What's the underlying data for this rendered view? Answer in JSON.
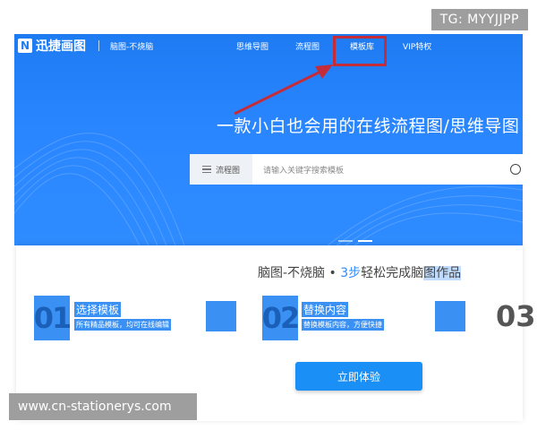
{
  "watermarks": {
    "top": "TG: MYYJJPP",
    "bottom": "www.cn-stationerys.com"
  },
  "header": {
    "logo_text": "迅捷画图",
    "slogan": "脑图-不烧脑",
    "nav": [
      "思维导图",
      "流程图",
      "模板库",
      "VIP特权"
    ]
  },
  "hero": {
    "headline": "一款小白也会用的在线流程图/思维导图",
    "search": {
      "type_label": "流程图",
      "placeholder": "请输入关键字搜索模板"
    }
  },
  "steps_section": {
    "subtitle_prefix": "脑图-不烧脑 • ",
    "subtitle_num": "3步",
    "subtitle_mid": "轻松完成脑",
    "subtitle_end": "图作品",
    "steps": [
      {
        "num": "01",
        "title": "选择模板",
        "desc": "所有精品模板，均可在线编辑"
      },
      {
        "num": "02",
        "title": "替换内容",
        "desc": "替换模板内容，方便快捷"
      },
      {
        "num": "03"
      }
    ],
    "cta_label": "立即体验"
  },
  "colors": {
    "brand_blue": "#2f8cff",
    "highlight_red": "#c42c3a"
  },
  "icons": [
    "logo-icon",
    "menu-icon",
    "search-icon",
    "arrow-annotation"
  ]
}
